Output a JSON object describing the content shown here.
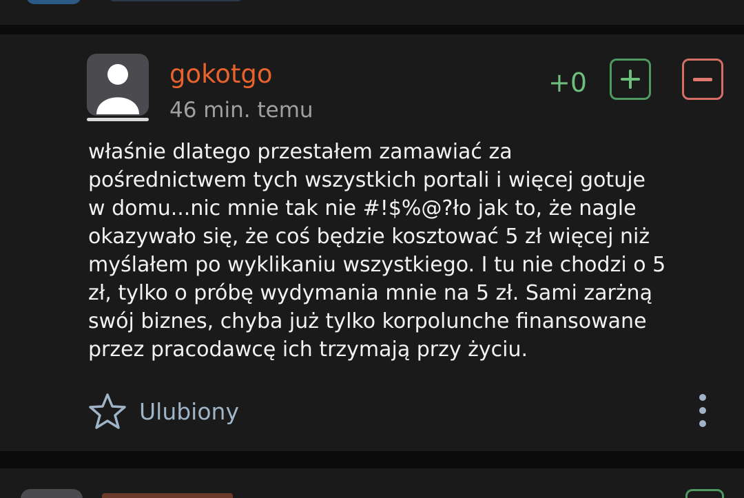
{
  "comment": {
    "username": "gokotgo",
    "timestamp": "46 min. temu",
    "score": "+0",
    "text": "właśnie dlatego przestałem zamawiać za\npośrednictwem tych wszystkich portali i więcej gotuje\nw domu...nic mnie tak nie #!$%@?ło jak to, że nagle\nokazywało się, że coś będzie kosztować 5 zł więcej niż\nmyślałem po wyklikaniu wszystkiego. I tu nie chodzi o 5\nzł, tylko o próbę wydymania mnie na 5 zł. Sami zarżną\nswój biznes, chyba już tylko korpolunche finansowane\nprzez pracodawcę ich trzymają przy życiu.",
    "favorite_label": "Ulubiony"
  },
  "icons": {
    "avatar": "user-avatar-placeholder",
    "upvote": "plus-icon",
    "downvote": "minus-icon",
    "favorite": "star-outline-icon",
    "more": "more-vertical-icon"
  },
  "colors": {
    "username": "#e8622c",
    "score": "#6fbf7c",
    "upvote": "#4e9a61",
    "downvote": "#d56f66",
    "accent": "#9fb4c7",
    "card_bg": "#1a1a1a",
    "page_bg": "#0b0b0b"
  }
}
